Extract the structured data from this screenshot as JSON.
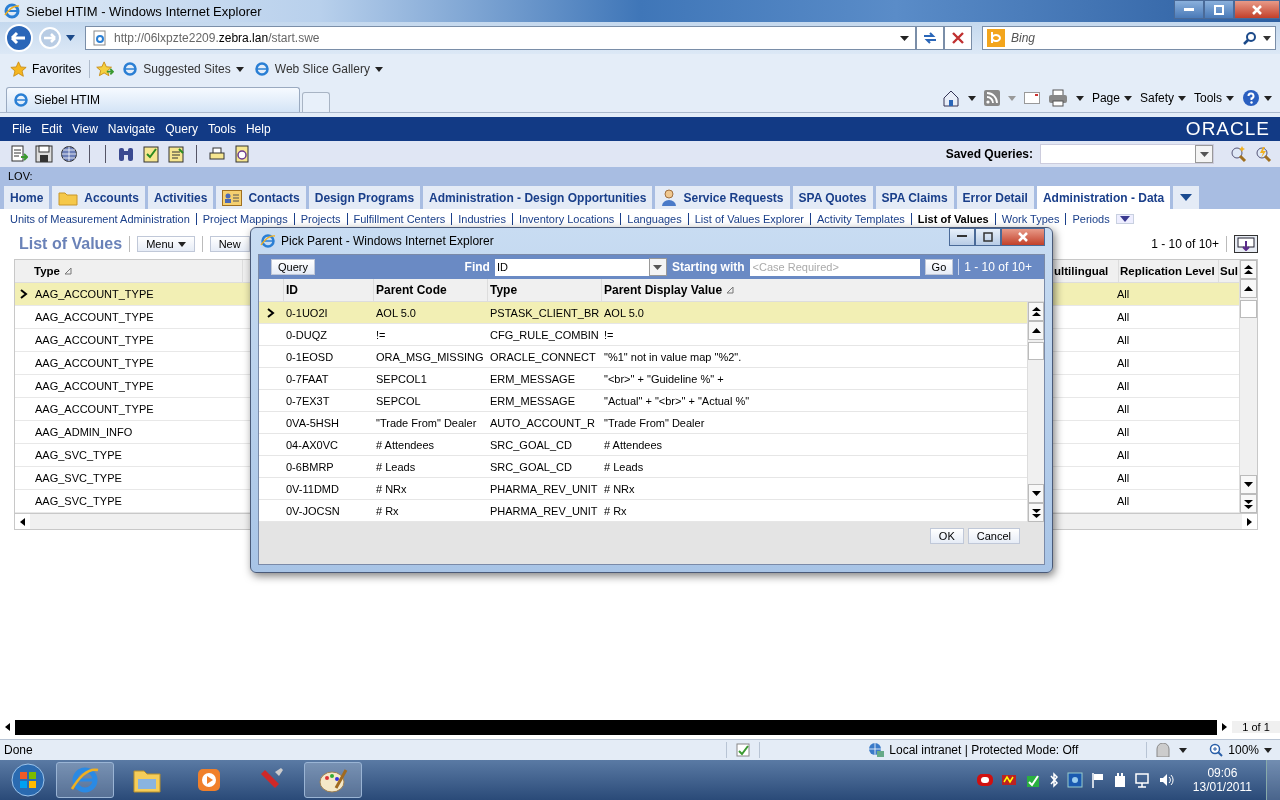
{
  "browser": {
    "title": "Siebel HTIM - Windows Internet Explorer",
    "address_prefix": "http://06lxpzte2209.",
    "address_host": "zebra.lan",
    "address_suffix": "/start.swe",
    "search_placeholder": "Bing",
    "favorites": "Favorites",
    "links": [
      "Suggested Sites",
      "Web Slice Gallery"
    ],
    "tab": "Siebel HTIM",
    "commands": [
      "Page",
      "Safety",
      "Tools"
    ]
  },
  "app": {
    "menu": [
      "File",
      "Edit",
      "View",
      "Navigate",
      "Query",
      "Tools",
      "Help"
    ],
    "logo": "ORACLE",
    "saved_queries": "Saved Queries:",
    "lov_label": "LOV:",
    "tabs": [
      {
        "label": "Home",
        "kind": "plain",
        "selected": false
      },
      {
        "label": "Accounts",
        "kind": "folder",
        "selected": false
      },
      {
        "label": "Activities",
        "kind": "plain",
        "selected": false
      },
      {
        "label": "Contacts",
        "kind": "card",
        "selected": false
      },
      {
        "label": "Design Programs",
        "kind": "plain",
        "selected": false
      },
      {
        "label": "Administration - Design Opportunities",
        "kind": "plain",
        "selected": false
      },
      {
        "label": "Service Requests",
        "kind": "person",
        "selected": false
      },
      {
        "label": "SPA Quotes",
        "kind": "plain",
        "selected": false
      },
      {
        "label": "SPA Claims",
        "kind": "plain",
        "selected": false
      },
      {
        "label": "Error Detail",
        "kind": "plain",
        "selected": false
      },
      {
        "label": "Administration - Data",
        "kind": "plain",
        "selected": true
      }
    ],
    "subtabs": [
      {
        "label": "Units of Measurement Administration",
        "selected": false
      },
      {
        "label": "Project Mappings",
        "selected": false
      },
      {
        "label": "Projects",
        "selected": false
      },
      {
        "label": "Fulfillment Centers",
        "selected": false
      },
      {
        "label": "Industries",
        "selected": false
      },
      {
        "label": "Inventory Locations",
        "selected": false
      },
      {
        "label": "Languages",
        "selected": false
      },
      {
        "label": "List of Values Explorer",
        "selected": false
      },
      {
        "label": "Activity Templates",
        "selected": false
      },
      {
        "label": "List of Values",
        "selected": true
      },
      {
        "label": "Work Types",
        "selected": false
      },
      {
        "label": "Periods",
        "selected": false
      }
    ],
    "list": {
      "title": "List of Values",
      "menu_button": "Menu",
      "new_button": "New",
      "count": "1 - 10 of 10+",
      "columns": [
        "Type",
        "ultilingual",
        "Replication Level",
        "Sul"
      ],
      "rows": [
        {
          "type": "AAG_ACCOUNT_TYPE",
          "replication": "All",
          "selected": true
        },
        {
          "type": "AAG_ACCOUNT_TYPE",
          "replication": "All",
          "selected": false
        },
        {
          "type": "AAG_ACCOUNT_TYPE",
          "replication": "All",
          "selected": false
        },
        {
          "type": "AAG_ACCOUNT_TYPE",
          "replication": "All",
          "selected": false
        },
        {
          "type": "AAG_ACCOUNT_TYPE",
          "replication": "All",
          "selected": false
        },
        {
          "type": "AAG_ACCOUNT_TYPE",
          "replication": "All",
          "selected": false
        },
        {
          "type": "AAG_ADMIN_INFO",
          "replication": "All",
          "selected": false
        },
        {
          "type": "AAG_SVC_TYPE",
          "replication": "All",
          "selected": false
        },
        {
          "type": "AAG_SVC_TYPE",
          "replication": "All",
          "selected": false
        },
        {
          "type": "AAG_SVC_TYPE",
          "replication": "All",
          "selected": false
        }
      ],
      "page_count": "1 of 1"
    }
  },
  "dialog": {
    "title": "Pick Parent - Windows Internet Explorer",
    "query_button": "Query",
    "find_label": "Find",
    "find_value": "ID",
    "starting_label": "Starting with",
    "starting_placeholder": "<Case Required>",
    "go_button": "Go",
    "count": "1 - 10 of 10+",
    "columns": [
      "ID",
      "Parent Code",
      "Type",
      "Parent Display Value"
    ],
    "rows": [
      {
        "id": "0-1UO2I",
        "parent_code": "AOL 5.0",
        "type": "PSTASK_CLIENT_BR",
        "value": "AOL 5.0",
        "selected": true
      },
      {
        "id": "0-DUQZ",
        "parent_code": "!=",
        "type": "CFG_RULE_COMBIN",
        "value": "!=",
        "selected": false
      },
      {
        "id": "0-1EOSD",
        "parent_code": "ORA_MSG_MISSING",
        "type": "ORACLE_CONNECT",
        "value": "\"%1\" not in value map \"%2\".",
        "selected": false
      },
      {
        "id": "0-7FAAT",
        "parent_code": "SEPCOL1",
        "type": "ERM_MESSAGE",
        "value": "\"<br>\" + \"Guideline %\" +",
        "selected": false
      },
      {
        "id": "0-7EX3T",
        "parent_code": "SEPCOL",
        "type": "ERM_MESSAGE",
        "value": "\"Actual\" + \"<br>\" + \"Actual %\"",
        "selected": false
      },
      {
        "id": "0VA-5HSH",
        "parent_code": "\"Trade From\" Dealer",
        "type": "AUTO_ACCOUNT_R",
        "value": "\"Trade From\" Dealer",
        "selected": false
      },
      {
        "id": "04-AX0VC",
        "parent_code": "# Attendees",
        "type": "SRC_GOAL_CD",
        "value": "# Attendees",
        "selected": false
      },
      {
        "id": "0-6BMRP",
        "parent_code": "# Leads",
        "type": "SRC_GOAL_CD",
        "value": "# Leads",
        "selected": false
      },
      {
        "id": "0V-11DMD",
        "parent_code": "# NRx",
        "type": "PHARMA_REV_UNIT",
        "value": "# NRx",
        "selected": false
      },
      {
        "id": "0V-JOCSN",
        "parent_code": "# Rx",
        "type": "PHARMA_REV_UNIT",
        "value": "# Rx",
        "selected": false
      }
    ],
    "ok_button": "OK",
    "cancel_button": "Cancel"
  },
  "status_bar": {
    "text": "Done",
    "zone": "Local intranet | Protected Mode: Off",
    "zoom": "100%"
  },
  "taskbar": {
    "time": "09:06",
    "date": "13/01/2011"
  }
}
